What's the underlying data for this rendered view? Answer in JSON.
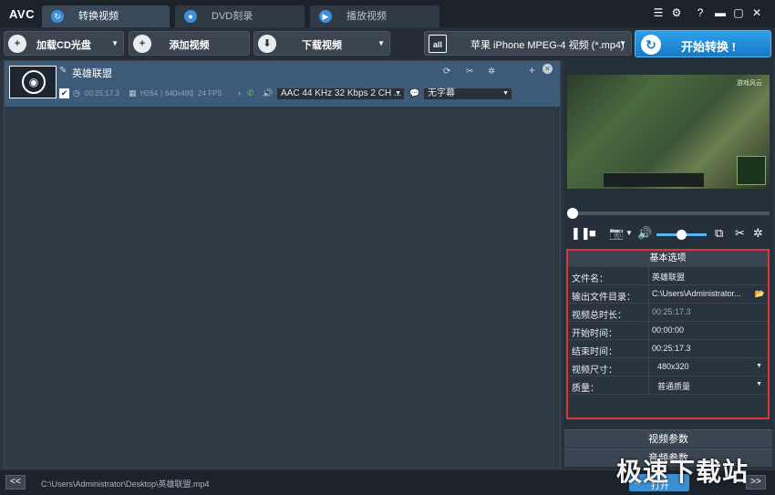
{
  "app": {
    "logo": "AVC"
  },
  "tabs": [
    {
      "label": "转换视频",
      "icon": "convert-icon"
    },
    {
      "label": "DVD刻录",
      "icon": "disc-icon"
    },
    {
      "label": "播放视频",
      "icon": "play-icon"
    }
  ],
  "window_buttons": [
    "menu-icon",
    "gear-icon",
    "help-icon",
    "minimize-icon",
    "maximize-icon",
    "close-icon"
  ],
  "toolbar": {
    "add_cd": "加载CD光盘",
    "add_video": "添加视频",
    "download_video": "下载视频",
    "profile": "苹果 iPhone MPEG-4 视频 (*.mp4)",
    "profile_icon_text": "all",
    "start": "开始转换 !"
  },
  "file": {
    "name": "英雄联盟",
    "duration": "00:25:17.3",
    "codec": "H264",
    "resolution": "640x480",
    "fps": "24 FPS",
    "audio": "AAC 44 KHz 32 Kbps 2 CH ...",
    "subtitle": "无字幕",
    "checked": true
  },
  "preview": {
    "watermark": "游戏风云"
  },
  "basic_options": {
    "title": "基本选项",
    "rows": [
      {
        "key": "文件名：",
        "value": "英雄联盟"
      },
      {
        "key": "输出文件目录：",
        "value": "C:\\Users\\Administrator..."
      },
      {
        "key": "视频总时长：",
        "value": "00:25:17.3"
      },
      {
        "key": "开始时间：",
        "value": "00:00:00"
      },
      {
        "key": "结束时间：",
        "value": "00:25:17.3"
      },
      {
        "key": "视频尺寸：",
        "value": "480x320"
      },
      {
        "key": "质量：",
        "value": "普通质量"
      }
    ]
  },
  "sections": {
    "video_params": "视频参数",
    "audio_params": "音频参数"
  },
  "status": {
    "back": "<<",
    "path": "C:\\Users\\Administrator\\Desktop\\英雄联盟.mp4",
    "open": "打开",
    "forward": ">>"
  },
  "watermark": "极速下载站"
}
